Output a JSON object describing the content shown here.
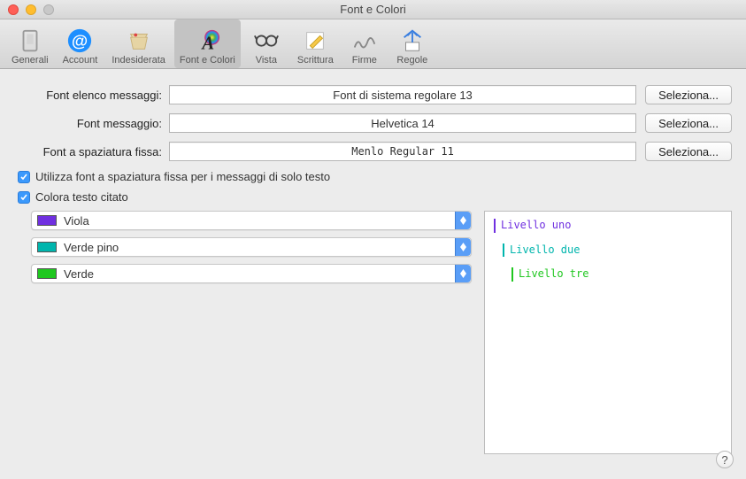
{
  "window": {
    "title": "Font e Colori"
  },
  "toolbar": {
    "items": [
      {
        "label": "Generali"
      },
      {
        "label": "Account"
      },
      {
        "label": "Indesiderata"
      },
      {
        "label": "Font e Colori"
      },
      {
        "label": "Vista"
      },
      {
        "label": "Scrittura"
      },
      {
        "label": "Firme"
      },
      {
        "label": "Regole"
      }
    ]
  },
  "fontRows": {
    "listLabel": "Font elenco messaggi:",
    "listValue": "Font di sistema regolare 13",
    "msgLabel": "Font messaggio:",
    "msgValue": "Helvetica 14",
    "fixedLabel": "Font a spaziatura fissa:",
    "fixedValue": "Menlo Regular 11",
    "selectButton": "Seleziona..."
  },
  "checks": {
    "fixedWidth": "Utilizza font a spaziatura fissa per i messaggi di solo testo",
    "colorQuoted": "Colora testo citato"
  },
  "colorSelects": [
    {
      "label": "Viola",
      "color": "#7030e0"
    },
    {
      "label": "Verde pino",
      "color": "#00b5ad"
    },
    {
      "label": "Verde",
      "color": "#1fc71f"
    }
  ],
  "preview": [
    {
      "text": "Livello uno",
      "color": "#7030e0",
      "indent": 0
    },
    {
      "text": "Livello due",
      "color": "#00b5ad",
      "indent": 1
    },
    {
      "text": "Livello tre",
      "color": "#1fc71f",
      "indent": 2
    }
  ]
}
